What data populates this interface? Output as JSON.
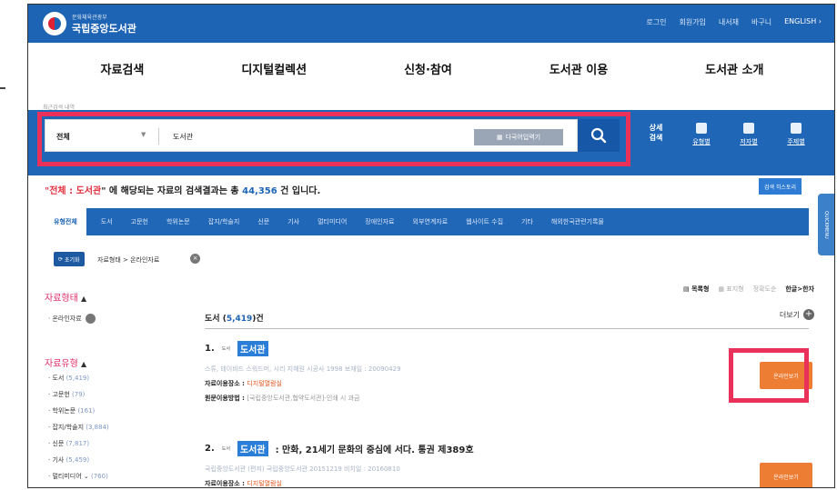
{
  "header": {
    "logo_sub": "문화체육관광부",
    "logo_main": "국립중앙도서관",
    "links": [
      "로그인",
      "회원가입",
      "내서재",
      "바구니",
      "ENGLISH ›"
    ]
  },
  "gnb": [
    "자료검색",
    "디지털컬렉션",
    "신청·참여",
    "도서관 이용",
    "도서관 소개"
  ],
  "recent_search": "최근검색 내역",
  "search": {
    "scope": "전체",
    "query": "도서관",
    "lang_button": "다국어입력기",
    "advanced": "상세\n검색",
    "advanced_items": [
      "유형별",
      "저자별",
      "주제별"
    ]
  },
  "summary": {
    "prefix": "\"",
    "scope": "전체",
    "sep": " : ",
    "query": "도서관",
    "mid": "\" 에 해당되는 자료의 검색결과는 총 ",
    "count": "44,356",
    "suffix": " 건 입니다."
  },
  "history_button": "검색 히스토리",
  "tabs": [
    "유형전체",
    "도서",
    "고문헌",
    "학위논문",
    "잡지/학술지",
    "신문",
    "기사",
    "멀티미디어",
    "장애인자료",
    "외부연계자료",
    "웹사이트 수집",
    "기타",
    "해외한국관련기록물"
  ],
  "quick_label": "QUICKMENU",
  "filter": {
    "reset": "초기화",
    "crumb": "자료형태 > 온라인자료"
  },
  "facets": {
    "form_title": "자료형태",
    "form_items": [
      {
        "label": "· 온라인자료",
        "count": ""
      }
    ],
    "type_title": "자료유형",
    "type_items": [
      {
        "label": "· 도서",
        "count": "(5,419)"
      },
      {
        "label": "· 고문헌",
        "count": "(79)"
      },
      {
        "label": "· 학위논문",
        "count": "(161)"
      },
      {
        "label": "· 잡지/학술지",
        "count": "(3,884)"
      },
      {
        "label": "· 신문",
        "count": "(7,817)"
      },
      {
        "label": "· 기사",
        "count": "(5,459)"
      },
      {
        "label": "· 멀티미디어 ⌄",
        "count": "(760)"
      }
    ]
  },
  "view_options": {
    "list": "목록형",
    "thumb": "표지형",
    "sort1": "정확도순",
    "sort2": "한글>한자"
  },
  "section": {
    "title": "도서 (",
    "count": "5,419",
    "suffix": ")건",
    "more": "더보기"
  },
  "results": [
    {
      "num": "1.",
      "type": "도서",
      "title_hl": "도서관",
      "title_rest": "",
      "meta": "스튜, 테이비드 스워드머, 시리 지혜원   시공사   1998   보재일 : 20090429",
      "loc_label": "자료이용장소 : ",
      "loc_value": "디지털열람실",
      "how_label": "원문이용방법 : ",
      "how_value": "[국립중앙도서관,협약도서관]-인쇄 시 과금",
      "online": "온라인보기"
    },
    {
      "num": "2.",
      "type": "도서",
      "title_hl": "도서관",
      "title_rest": ": 만화, 21세기 문화의 중심에 서다. 통권 제389호",
      "meta": "국립중앙도서관 (편저)   국립중앙도서관   20151219   비치일 : 20160810",
      "loc_label": "자료이용장소 : ",
      "loc_value": "디지털열람실",
      "how_label": "",
      "how_value": "",
      "online": "온라인보기"
    }
  ]
}
